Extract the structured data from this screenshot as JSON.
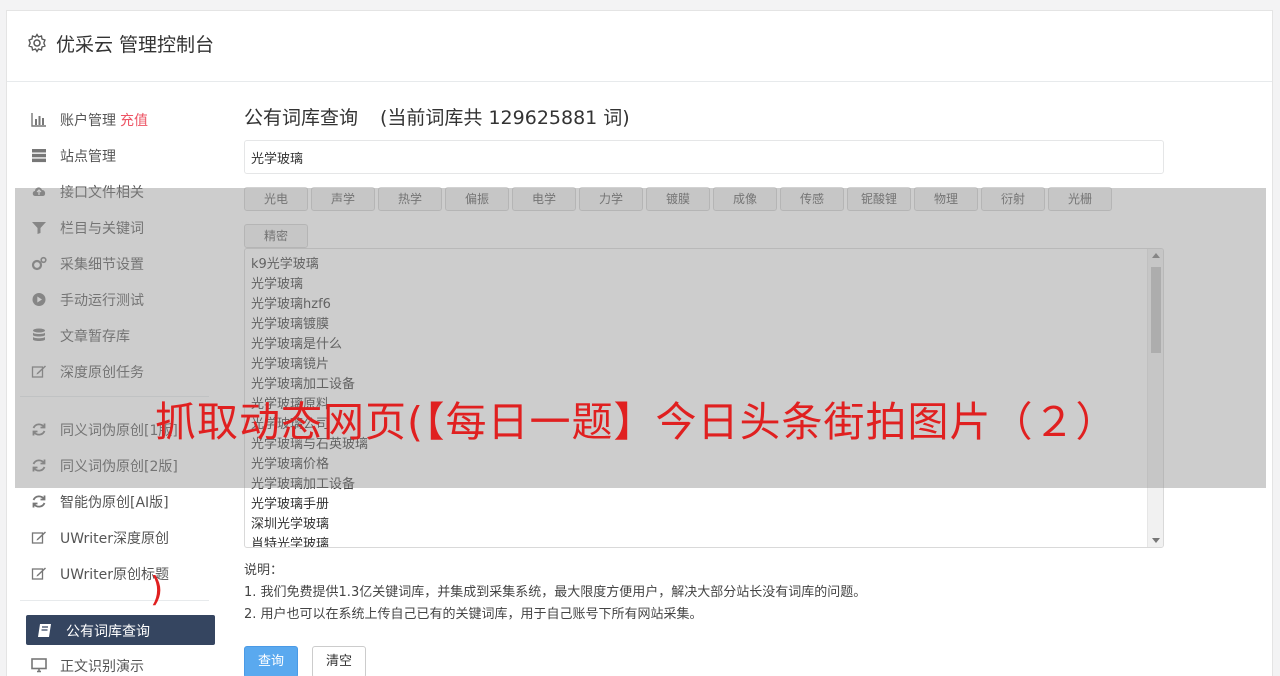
{
  "header": {
    "title": "优采云 管理控制台",
    "icon": "gear-icon"
  },
  "sidebar": {
    "items": [
      {
        "label": "账户管理",
        "badge": "充值",
        "icon": "bar-chart-icon"
      },
      {
        "label": "站点管理",
        "icon": "server-icon"
      },
      {
        "label": "接口文件相关",
        "icon": "cloud-upload-icon"
      },
      {
        "label": "栏目与关键词",
        "icon": "filter-icon"
      },
      {
        "label": "采集细节设置",
        "icon": "cogs-icon"
      },
      {
        "label": "手动运行测试",
        "icon": "play-circle-icon"
      },
      {
        "label": "文章暂存库",
        "icon": "database-icon"
      },
      {
        "label": "深度原创任务",
        "icon": "edit-icon"
      },
      {
        "label": "同义词伪原创[1版]",
        "icon": "refresh-icon"
      },
      {
        "label": "同义词伪原创[2版]",
        "icon": "refresh-icon"
      },
      {
        "label": "智能伪原创[AI版]",
        "icon": "refresh-icon"
      },
      {
        "label": "UWriter深度原创",
        "icon": "edit-icon"
      },
      {
        "label": "UWriter原创标题",
        "icon": "edit-icon"
      },
      {
        "label": "公有词库查询",
        "icon": "book-icon",
        "active": true
      },
      {
        "label": "正文识别演示",
        "icon": "desktop-icon"
      }
    ]
  },
  "main": {
    "title": "公有词库查询",
    "count_text": "(当前词库共 129625881 词)",
    "search_value": "光学玻璃",
    "tags": [
      "光电",
      "声学",
      "热学",
      "偏振",
      "电学",
      "力学",
      "镀膜",
      "成像",
      "传感",
      "铌酸锂",
      "物理",
      "衍射",
      "光栅",
      "精密"
    ],
    "results": [
      "k9光学玻璃",
      "光学玻璃",
      "光学玻璃hzf6",
      "光学玻璃镀膜",
      "光学玻璃是什么",
      "光学玻璃镜片",
      "光学玻璃加工设备",
      "光学玻璃原料",
      "光学玻璃公司",
      "光学玻璃与石英玻璃",
      "光学玻璃价格",
      "光学玻璃加工设备",
      "光学玻璃手册",
      "深圳光学玻璃",
      "肖特光学玻璃"
    ],
    "notes": {
      "heading": "说明：",
      "line1": "1. 我们免费提供1.3亿关键词库，并集成到采集系统，最大限度方便用户，解决大部分站长没有词库的问题。",
      "line2": "2. 用户也可以在系统上传自己已有的关键词库，用于自己账号下所有网站采集。"
    },
    "buttons": {
      "query": "查询",
      "clear": "清空"
    }
  },
  "overlay": {
    "text": "抓取动态网页(【每日一题】今日头条街拍图片（２）",
    "paren": ")"
  },
  "colors": {
    "active_nav": "#354560",
    "badge": "#ed5565",
    "primary_button": "#5aa9ef",
    "overlay_text": "#e02020"
  }
}
